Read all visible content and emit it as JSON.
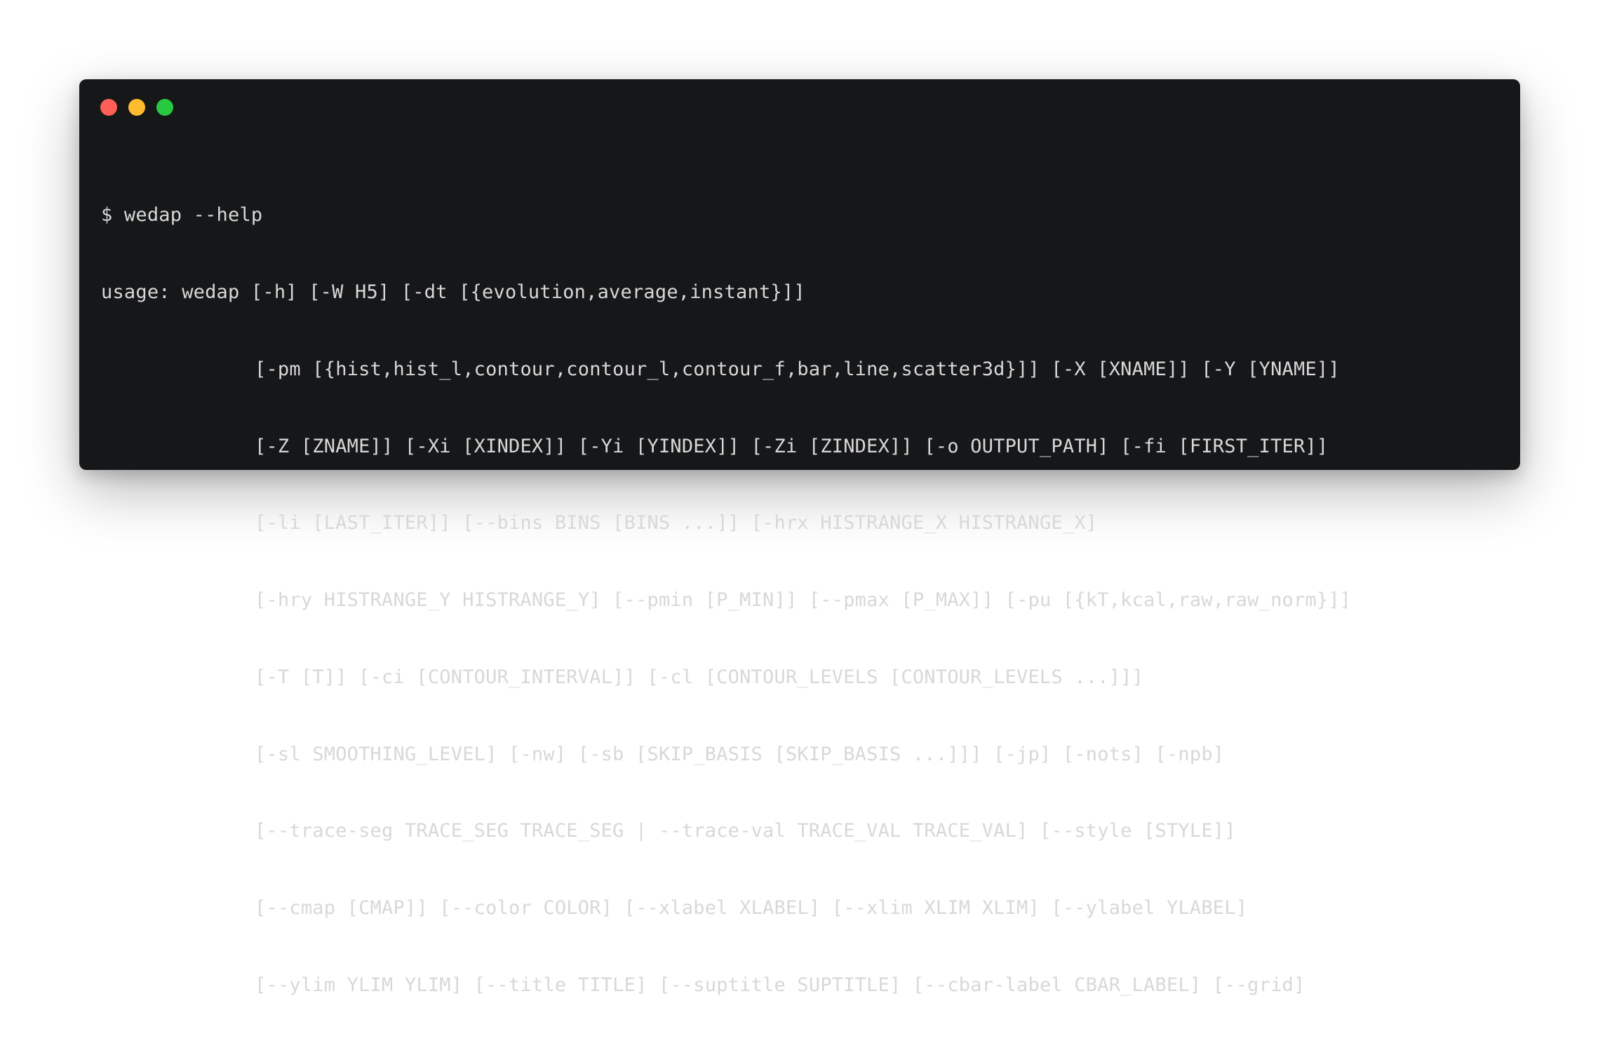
{
  "window": {
    "controls": {
      "close_color": "#ff5f57",
      "minimize_color": "#febc2e",
      "zoom_color": "#28c840"
    },
    "background": "#161719"
  },
  "terminal": {
    "prompt_line": "$ wedap --help",
    "usage_lines": [
      "usage: wedap [-h] [-W H5] [-dt [{evolution,average,instant}]]",
      "[-pm [{hist,hist_l,contour,contour_l,contour_f,bar,line,scatter3d}]] [-X [XNAME]] [-Y [YNAME]]",
      "[-Z [ZNAME]] [-Xi [XINDEX]] [-Yi [YINDEX]] [-Zi [ZINDEX]] [-o OUTPUT_PATH] [-fi [FIRST_ITER]]",
      "[-li [LAST_ITER]] [--bins BINS [BINS ...]] [-hrx HISTRANGE_X HISTRANGE_X]",
      "[-hry HISTRANGE_Y HISTRANGE_Y] [--pmin [P_MIN]] [--pmax [P_MAX]] [-pu [{kT,kcal,raw,raw_norm}]]",
      "[-T [T]] [-ci [CONTOUR_INTERVAL]] [-cl [CONTOUR_LEVELS [CONTOUR_LEVELS ...]]]",
      "[-sl SMOOTHING_LEVEL] [-nw] [-sb [SKIP_BASIS [SKIP_BASIS ...]]] [-jp] [-nots] [-npb]",
      "[--trace-seg TRACE_SEG TRACE_SEG | --trace-val TRACE_VAL TRACE_VAL] [--style [STYLE]]",
      "[--cmap [CMAP]] [--color COLOR] [--xlabel XLABEL] [--xlim XLIM XLIM] [--ylabel YLABEL]",
      "[--ylim YLIM YLIM] [--title TITLE] [--suptitle SUPTITLE] [--cbar-label CBAR_LABEL] [--grid]"
    ]
  }
}
